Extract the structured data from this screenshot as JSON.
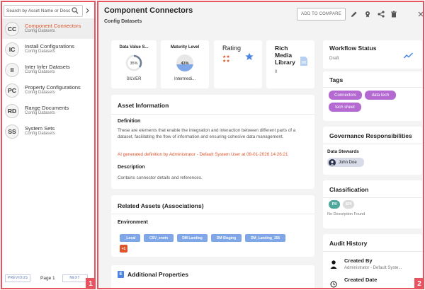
{
  "sidebar": {
    "search_placeholder": "Search by Asset Name or Description",
    "items": [
      {
        "initials": "CC",
        "name": "Component Connectors",
        "category": "Config Datasets",
        "selected": true
      },
      {
        "initials": "IC",
        "name": "Install Configurations",
        "category": "Config Datasets",
        "selected": false
      },
      {
        "initials": "II",
        "name": "Inter Infer Datasets",
        "category": "Config Datasets",
        "selected": false
      },
      {
        "initials": "PC",
        "name": "Property Configurations",
        "category": "Config Datasets",
        "selected": false
      },
      {
        "initials": "RD",
        "name": "Range Documents",
        "category": "Config Datasets",
        "selected": false
      },
      {
        "initials": "SS",
        "name": "System Sets",
        "category": "Config Datasets",
        "selected": false
      }
    ],
    "pager": {
      "previous": "PREVIOUS",
      "page_label": "Page 1",
      "next": "NEXT"
    },
    "badge": "1"
  },
  "header": {
    "title": "Component Connectors",
    "subtitle": "Config Datasets",
    "compare_label": "ADD TO COMPARE",
    "icons": [
      "pencil-icon",
      "badge-icon",
      "share-icon",
      "trash-icon",
      "close-icon"
    ]
  },
  "metrics": {
    "data_value": {
      "title": "Data Value S...",
      "percent": "35%",
      "percent_value": 35,
      "label": "SILVER"
    },
    "maturity": {
      "title": "Maturity Level",
      "percent": "43%",
      "percent_value": 43,
      "label": "Intermedi..."
    },
    "rating": {
      "title": "Rating",
      "icon": "star-icon"
    },
    "rich_media": {
      "title": "Rich Media Library",
      "count": "0",
      "icon": "document-icon"
    }
  },
  "asset_info": {
    "title": "Asset Information",
    "definition_label": "Definition",
    "definition_text": "These are elements that enable the integration and interaction between different parts of a dataset, facilitating the flow of information and ensuring cohesive data management.",
    "ai_note": "AI generated definition by Administrator - Default System User at 08-01-2026 14:26:21",
    "description_label": "Description",
    "description_text": "Contains connector details and references."
  },
  "related_assets": {
    "title": "Related Assets (Associations)",
    "environment_label": "Environment",
    "chips": [
      "_Local",
      "CSV_erwin",
      "DM Landing",
      "DM Staging",
      "DM_Landing_156"
    ],
    "more_label": "+1"
  },
  "additional_props": {
    "title": "Additional Properties",
    "icon_letter": "E"
  },
  "workflow": {
    "title": "Workflow Status",
    "status": "Draft"
  },
  "tags": {
    "title": "Tags",
    "items": [
      "Connectors",
      "data tech",
      "tech sheet"
    ]
  },
  "governance": {
    "title": "Governance Responsibilities",
    "stewards_label": "Data Stewards",
    "steward": "John Doe"
  },
  "classification": {
    "title": "Classification",
    "pills": [
      "PII",
      "SPI"
    ],
    "empty_text": "No Description Found"
  },
  "audit": {
    "title": "Audit History",
    "entries": [
      {
        "label": "Created By",
        "value": "Administrator - Default Syste..."
      },
      {
        "label": "Created Date",
        "value": ""
      }
    ]
  },
  "panel_badge": "2",
  "colors": {
    "accent": "#e0542c",
    "chip": "#7fa6e6",
    "tag": "#b46ad1",
    "badge": "#e8535f",
    "classification": "#4fa69a"
  }
}
